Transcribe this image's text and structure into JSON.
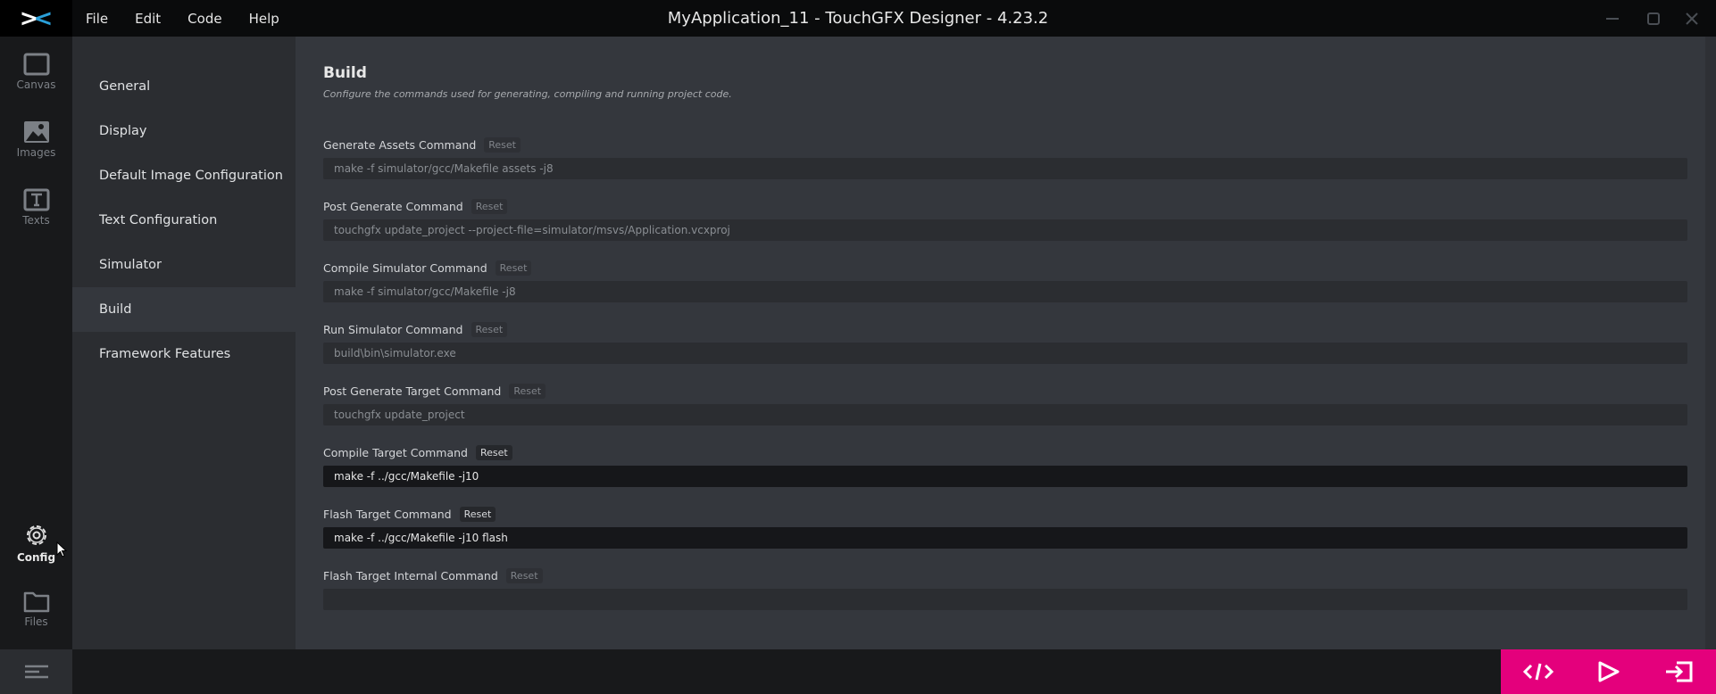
{
  "titlebar": {
    "title": "MyApplication_11 - TouchGFX Designer - 4.23.2",
    "menu": [
      "File",
      "Edit",
      "Code",
      "Help"
    ],
    "logo": "X"
  },
  "rail": [
    {
      "label": "Canvas",
      "icon": "canvas-icon"
    },
    {
      "label": "Images",
      "icon": "image-icon"
    },
    {
      "label": "Texts",
      "icon": "text-icon"
    },
    {
      "label": "Config",
      "icon": "gear-icon"
    },
    {
      "label": "Files",
      "icon": "folder-icon"
    }
  ],
  "nav": [
    "General",
    "Display",
    "Default Image Configuration",
    "Text Configuration",
    "Simulator",
    "Build",
    "Framework Features"
  ],
  "main": {
    "heading": "Build",
    "subtitle": "Configure the commands used for generating, compiling and running project code.",
    "reset_label": "Reset",
    "fields": [
      {
        "label": "Generate Assets Command",
        "value": "make -f simulator/gcc/Makefile assets -j8",
        "custom": false
      },
      {
        "label": "Post Generate Command",
        "value": "touchgfx update_project --project-file=simulator/msvs/Application.vcxproj",
        "custom": false
      },
      {
        "label": "Compile Simulator Command",
        "value": "make -f simulator/gcc/Makefile -j8",
        "custom": false
      },
      {
        "label": "Run Simulator Command",
        "value": "build\\bin\\simulator.exe",
        "custom": false
      },
      {
        "label": "Post Generate Target Command",
        "value": "touchgfx update_project",
        "custom": false
      },
      {
        "label": "Compile Target Command",
        "value": "make -f ../gcc/Makefile -j10",
        "custom": true
      },
      {
        "label": "Flash Target Command",
        "value": "make -f ../gcc/Makefile -j10 flash",
        "custom": true
      },
      {
        "label": "Flash Target Internal Command",
        "value": "",
        "custom": false
      }
    ]
  },
  "colors": {
    "accent": "#e4007c",
    "logo_blue": "#2a9fd8"
  }
}
